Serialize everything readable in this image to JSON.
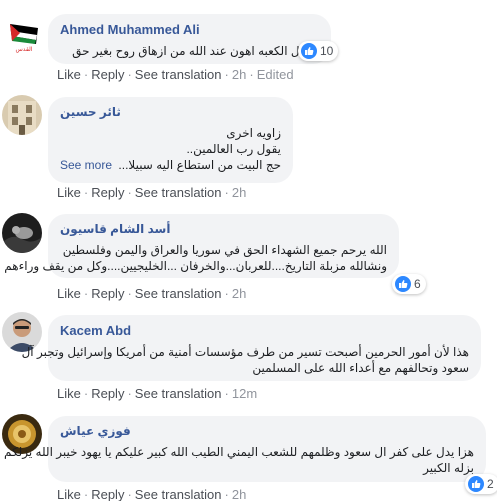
{
  "actions": {
    "like": "Like",
    "reply": "Reply",
    "see_translation": "See translation",
    "separator": "·"
  },
  "comments": [
    {
      "author": "Ahmed Muhammed Ali",
      "avatar": "flag-avatar",
      "lines": [
        "لزوال الكعبه اهون عند الله من ازهاق روح بغير حق"
      ],
      "reactions": "10",
      "time": "2h",
      "edited": "Edited"
    },
    {
      "author": "ثائر حسين",
      "avatar": "building-avatar",
      "lines": [
        "زاويه اخرى",
        "يقول رب العالمين..",
        "حج البيت من استطاع اليه سبيلا..."
      ],
      "see_more": "See more",
      "time": "2h"
    },
    {
      "author": "أسد الشام قاسيون",
      "avatar": "dark-avatar",
      "lines": [
        "الله يرحم جميع الشهداء الحق في سوريا والعراق واليمن وفلسطين",
        "ونشالله مزبلة التاريخ....للعربان...والخرفان ...الخليجيين....وكل من يقف وراءهم"
      ],
      "reactions": "6",
      "time": "2h"
    },
    {
      "author": "Kacem Abd",
      "avatar": "person-avatar",
      "lines": [
        "هذا لأن أمور الحرمين أصبحت تسير من طرف مؤسسات أمنية من أمريكا وإسرائيل وتجبر آل",
        "سعود وتحالفهم مع أعداء الله على المسلمين"
      ],
      "time": "12m"
    },
    {
      "author": "فوزي عياش",
      "avatar": "gold-avatar",
      "lines": [
        "هزا يدل على كفر ال سعود وظلمهم للشعب اليمني الطيب الله كبير عليكم يا يهود خيبر الله يزلكم",
        "بزله الكبير"
      ],
      "reactions": "2",
      "time": "2h"
    }
  ],
  "colors": {
    "link": "#385898",
    "bubble": "#f2f3f5",
    "like_blue": "#2d88ff",
    "meta": "#90949c"
  }
}
